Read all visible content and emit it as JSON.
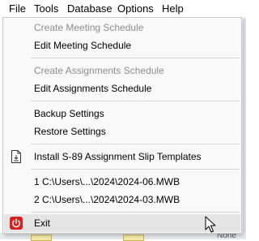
{
  "menubar": {
    "items": [
      "File",
      "Tools",
      "Database",
      "Options",
      "Help"
    ]
  },
  "background": {
    "cell_text": "None"
  },
  "file_menu": {
    "create_meeting": "Create Meeting Schedule",
    "edit_meeting": "Edit Meeting Schedule",
    "create_assignments": "Create Assignments Schedule",
    "edit_assignments": "Edit Assignments Schedule",
    "backup": "Backup Settings",
    "restore": "Restore Settings",
    "install_templates": "Install S-89 Assignment Slip Templates",
    "recent_files": [
      "1 C:\\Users\\...\\2024\\2024-06.MWB",
      "2 C:\\Users\\...\\2024\\2024-03.MWB"
    ],
    "exit": "Exit"
  },
  "icons": {
    "install_templates": "document-icon",
    "exit": "power-icon",
    "cursor": "mouse-pointer-icon"
  },
  "colors": {
    "exit_icon": "#d92020",
    "disabled_text": "#8d8d8d",
    "hover_background": "#e5e5e5"
  }
}
